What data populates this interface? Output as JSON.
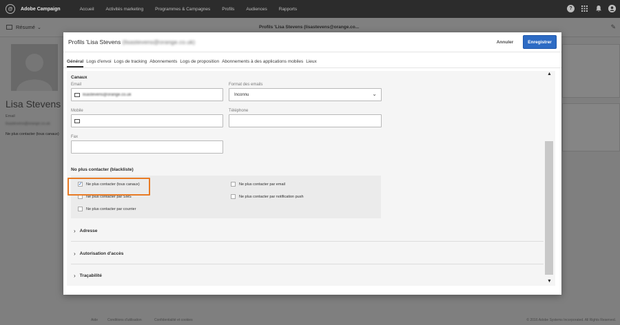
{
  "app": {
    "name": "Adobe Campaign",
    "nav": [
      "Accueil",
      "Activités marketing",
      "Programmes & Campagnes",
      "Profils",
      "Audiences",
      "Rapports"
    ]
  },
  "background": {
    "summary_label": "Résumé",
    "page_title": "Profils 'Lisa Stevens (lisastevens@orange.co...",
    "profile_name": "Lisa Stevens",
    "email_label": "Email",
    "email_value": "lisastevens@orange.co.uk",
    "blacklist_text": "Ne plus contacter (tous canaux)",
    "footer_links": [
      "Aide",
      "Conditions d'utilisation",
      "Confidentialité et cookies"
    ],
    "copyright": "© 2016 Adobe Systems Incorporated. All Rights Reserved."
  },
  "modal": {
    "title": "Profils 'Lisa Stevens",
    "title_blurred": "(lisastevens@orange.co.uk)",
    "cancel_label": "Annuler",
    "save_label": "Enregistrer",
    "tabs": [
      "Général",
      "Logs d'envoi",
      "Logs de tracking",
      "Abonnements",
      "Logs de proposition",
      "Abonnements à des applications mobiles",
      "Lieux"
    ],
    "active_tab": "Général",
    "channels": {
      "title": "Canaux",
      "email_label": "Email",
      "email_value": "lisastevens@orange.co.uk",
      "format_label": "Format des emails",
      "format_value": "Inconnu",
      "mobile_label": "Mobile",
      "mobile_value": "",
      "phone_label": "Téléphone",
      "phone_value": "",
      "fax_label": "Fax",
      "fax_value": ""
    },
    "blacklist": {
      "title": "No plus contacter (blackliste)",
      "options": [
        {
          "label": "Ne plus contacter (tous canaux)",
          "checked": true
        },
        {
          "label": "Ne plus contacter par email",
          "checked": false
        },
        {
          "label": "Ne plus contacter par SMS",
          "checked": false
        },
        {
          "label": "Ne plus contacter par notification push",
          "checked": false
        },
        {
          "label": "Ne plus contacter par courrier",
          "checked": false
        }
      ]
    },
    "sections": [
      "Adresse",
      "Autorisation d'accès",
      "Traçabilité"
    ]
  },
  "colors": {
    "topbar": "#2c2c2c",
    "primary_button": "#2d6bc4",
    "highlight": "#e87a23"
  },
  "icons": [
    "bookmark-icon",
    "help-icon",
    "apps-grid-icon",
    "notification-bell-icon",
    "user-avatar-icon",
    "envelope-icon",
    "mobile-icon",
    "chevron-down-icon",
    "chevron-right-icon",
    "edit-pencil-icon"
  ]
}
